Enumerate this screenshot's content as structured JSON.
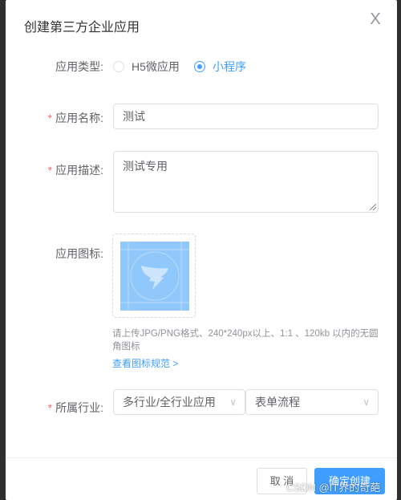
{
  "dialog": {
    "title": "创建第三方企业应用",
    "close_glyph": "X"
  },
  "form": {
    "type": {
      "label": "应用类型:",
      "options": [
        "H5微应用",
        "小程序"
      ],
      "selected": "小程序"
    },
    "name": {
      "required_mark": "*",
      "label": "应用名称:",
      "value": "测试"
    },
    "description": {
      "required_mark": "*",
      "label": "应用描述:",
      "value": "测试专用"
    },
    "icon": {
      "label": "应用图标:",
      "hint": "请上传JPG/PNG格式、240*240px以上、1:1 、120kb 以内的无圆角图标",
      "link": "查看图标规范",
      "link_chevron": ">"
    },
    "industry": {
      "required_mark": "*",
      "label": "所属行业:",
      "category": "多行业/全行业应用",
      "subcategory": "表单流程"
    }
  },
  "footer": {
    "cancel_label": "取 消",
    "confirm_label": "确定创建"
  },
  "watermark": "CSDN @IT界的奇葩",
  "icons": {
    "close": "close-icon",
    "chevron": "chevron-down-icon",
    "upload": "app-icon-placeholder"
  },
  "colors": {
    "primary": "#409eff",
    "required": "#f56c6c",
    "icon_bg": "#91c8fb"
  }
}
